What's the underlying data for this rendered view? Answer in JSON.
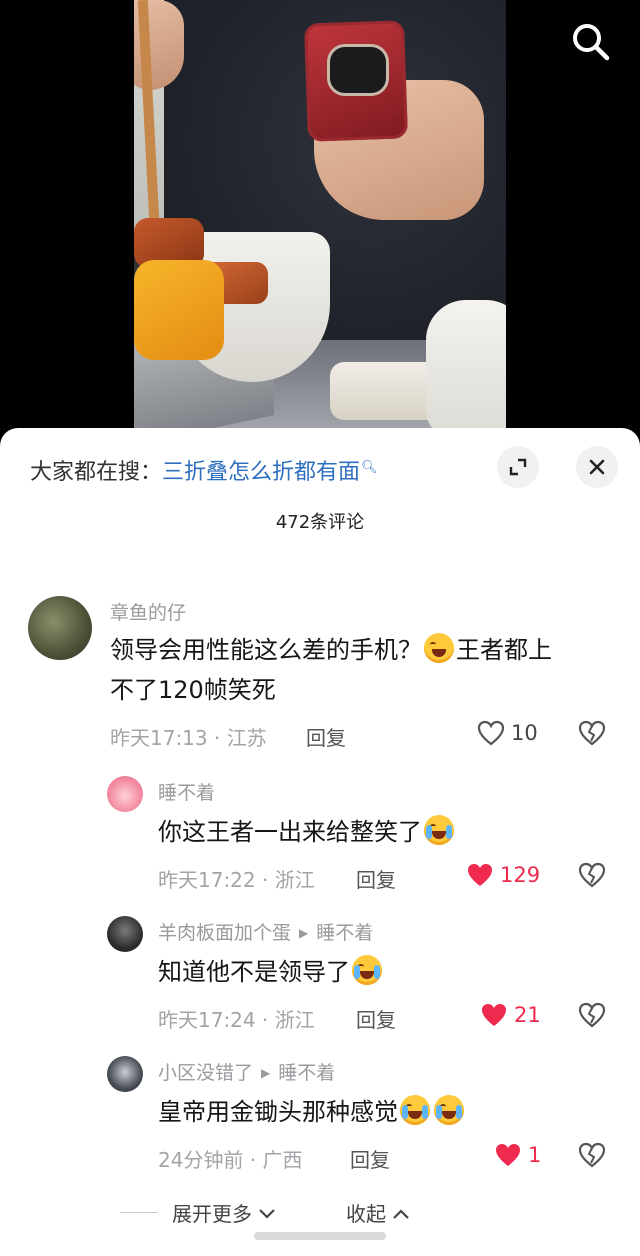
{
  "video": {
    "description_icon": "search-icon"
  },
  "panel": {
    "hot_search_prefix": "大家都在搜：",
    "hot_search_keyword": "三折叠怎么折都有面",
    "hot_search_icon": "search-small-icon",
    "expand_icon": "expand-icon",
    "close_icon": "close-icon",
    "comment_count": "472条评论"
  },
  "comments": [
    {
      "user": "章鱼的仔",
      "text_1": "领导会用性能这么差的手机？",
      "text_2": "王者都上",
      "text_3": "不了120帧笑死",
      "time": "昨天17:13 · 江苏",
      "reply": "回复",
      "likes": "10",
      "liked": false
    },
    {
      "user": "睡不着",
      "text": "你这王者一出来给整笑了",
      "time": "昨天17:22 · 浙江",
      "reply": "回复",
      "likes": "129",
      "liked": true
    },
    {
      "user": "羊肉板面加个蛋",
      "reply_to": "睡不着",
      "text": "知道他不是领导了",
      "time": "昨天17:24 · 浙江",
      "reply": "回复",
      "likes": "21",
      "liked": true
    },
    {
      "user": "小区没错了",
      "reply_to": "睡不着",
      "text": "皇帝用金锄头那种感觉",
      "time": "24分钟前 · 广西",
      "reply": "回复",
      "likes": "1",
      "liked": true
    }
  ],
  "footer": {
    "expand_label": "展开更多",
    "collapse_label": "收起"
  },
  "colors": {
    "keyword": "#2f6fc0",
    "like_active": "#ee2a4f",
    "meta": "#a3a3a8"
  }
}
